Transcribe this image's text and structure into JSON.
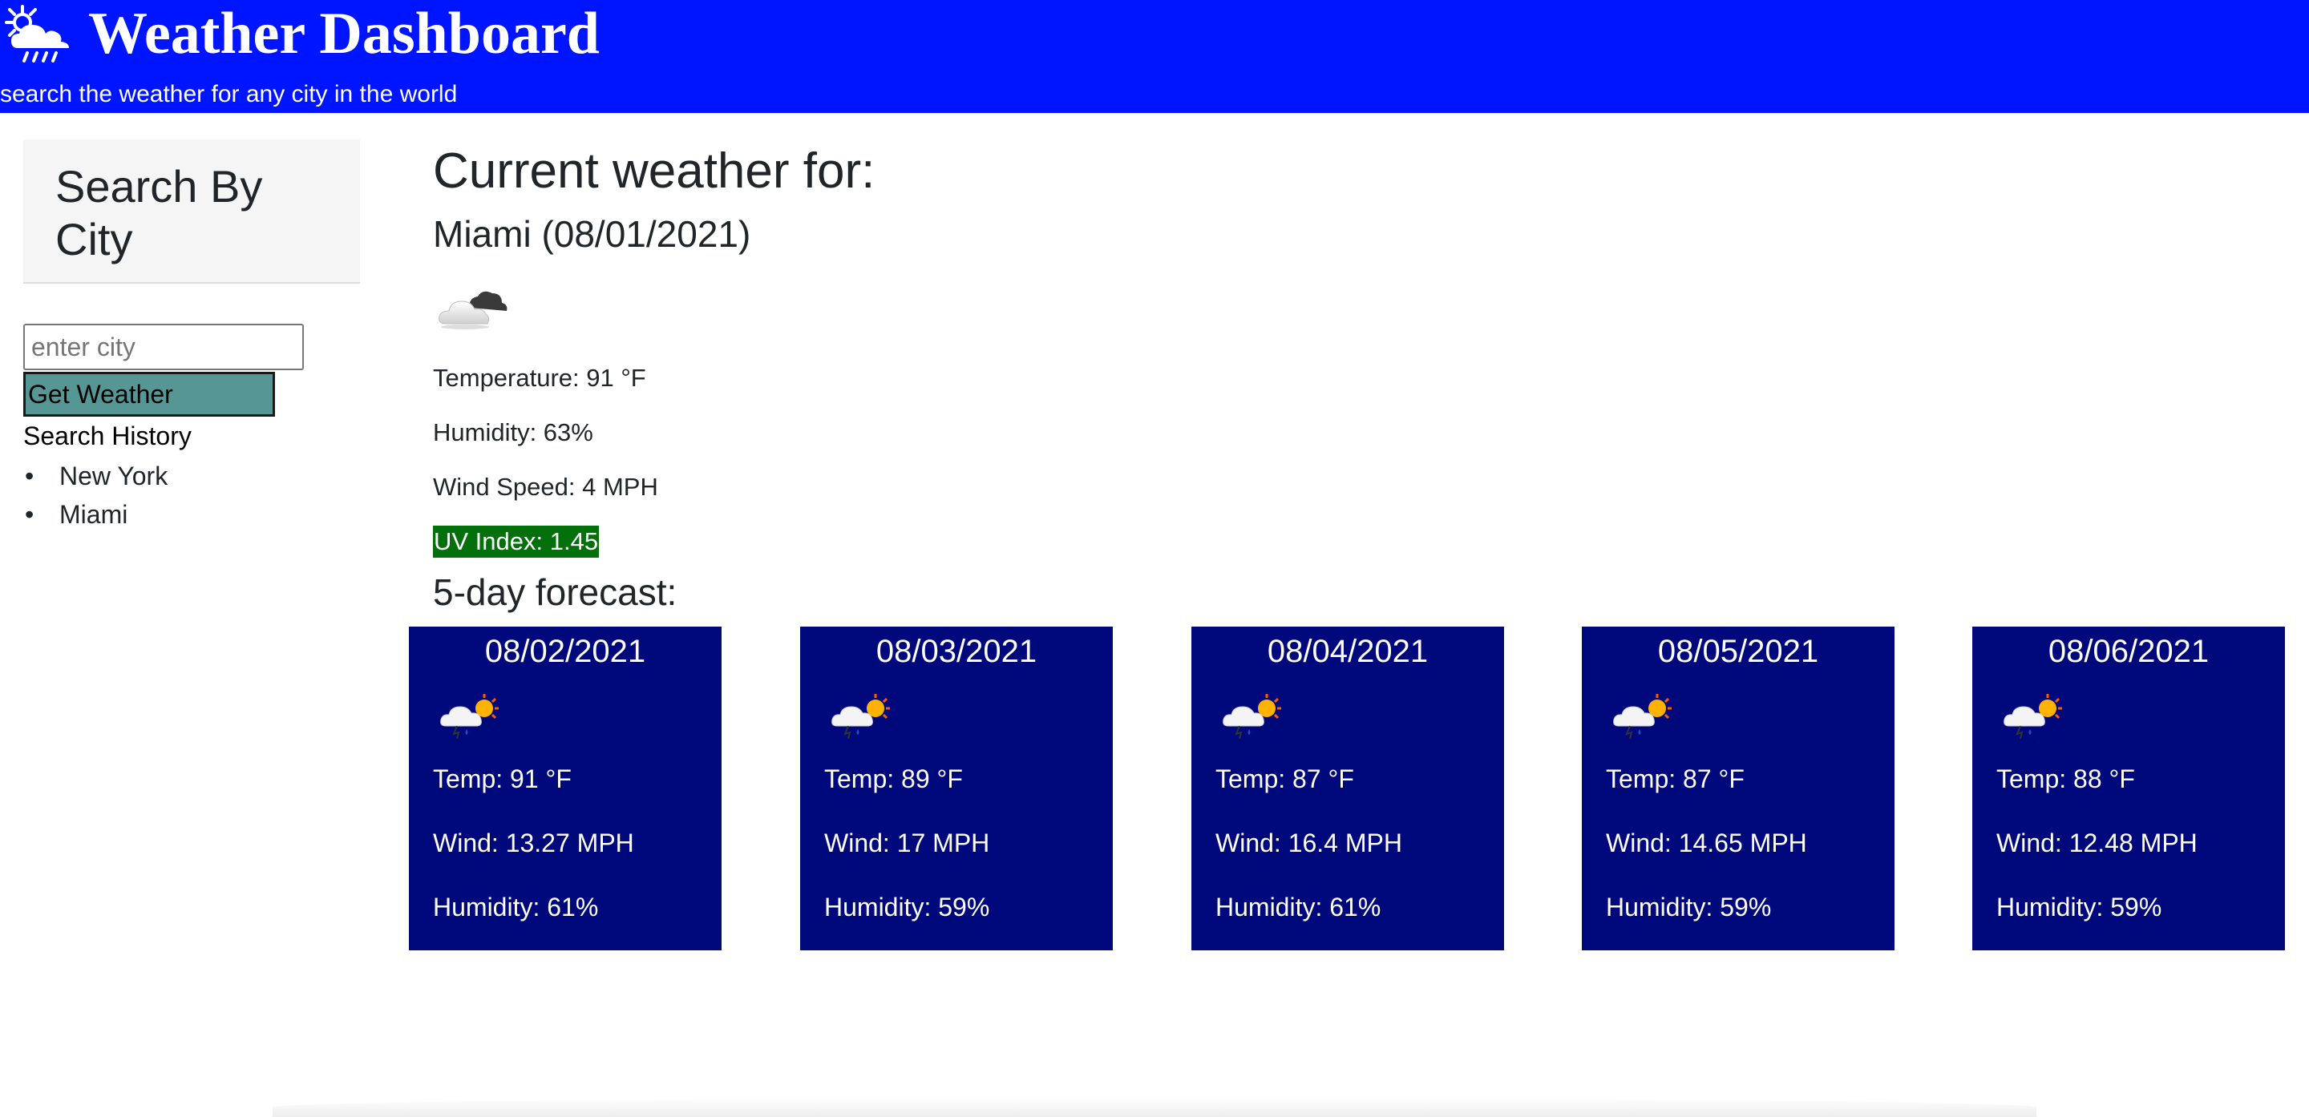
{
  "header": {
    "title": "Weather Dashboard",
    "subtitle": "search the weather for any city in the world",
    "icon": "sun-cloud-rain-icon",
    "background_color": "#0015ff"
  },
  "sidebar": {
    "title": "Search By City",
    "search": {
      "placeholder": "enter city",
      "value": ""
    },
    "button_label": "Get Weather",
    "button_color": "#569795",
    "history_label": "Search History",
    "history": [
      "New York",
      "Miami"
    ]
  },
  "current": {
    "heading": "Current weather for:",
    "city_date": "Miami (08/01/2021)",
    "icon": "cloudy-icon",
    "temperature": "Temperature: 91 °F",
    "humidity": "Humidity: 63%",
    "wind": "Wind Speed: 4 MPH",
    "uv": "UV Index: 1.45",
    "uv_color": "#03700c"
  },
  "forecast": {
    "heading": "5-day forecast:",
    "card_color": "#00097b",
    "days": [
      {
        "date": "08/02/2021",
        "icon": "thunderstorm-sun-icon",
        "temp": "Temp: 91 °F",
        "wind": "Wind: 13.27 MPH",
        "humidity": "Humidity: 61%"
      },
      {
        "date": "08/03/2021",
        "icon": "thunderstorm-sun-icon",
        "temp": "Temp: 89 °F",
        "wind": "Wind: 17 MPH",
        "humidity": "Humidity: 59%"
      },
      {
        "date": "08/04/2021",
        "icon": "thunderstorm-sun-icon",
        "temp": "Temp: 87 °F",
        "wind": "Wind: 16.4 MPH",
        "humidity": "Humidity: 61%"
      },
      {
        "date": "08/05/2021",
        "icon": "thunderstorm-sun-icon",
        "temp": "Temp: 87 °F",
        "wind": "Wind: 14.65 MPH",
        "humidity": "Humidity: 59%"
      },
      {
        "date": "08/06/2021",
        "icon": "thunderstorm-sun-icon",
        "temp": "Temp: 88 °F",
        "wind": "Wind: 12.48 MPH",
        "humidity": "Humidity: 59%"
      }
    ]
  }
}
